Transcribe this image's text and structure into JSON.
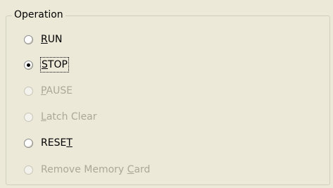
{
  "operation_group": {
    "title": "Operation",
    "options": [
      {
        "label": "RUN",
        "mnemonic": "R",
        "checked": false,
        "enabled": true
      },
      {
        "label": "STOP",
        "mnemonic": "S",
        "checked": true,
        "enabled": true,
        "focused": true
      },
      {
        "label": "PAUSE",
        "mnemonic": "P",
        "checked": false,
        "enabled": false
      },
      {
        "label": "Latch Clear",
        "mnemonic": "L",
        "checked": false,
        "enabled": false
      },
      {
        "label": "RESET",
        "mnemonic": "T",
        "checked": false,
        "enabled": true
      },
      {
        "label": "Remove Memory Card",
        "mnemonic": "C",
        "checked": false,
        "enabled": false
      }
    ]
  },
  "colors": {
    "background": "#ece9d8",
    "disabled_text": "#aca899",
    "group_border": "#d0d0bf"
  }
}
